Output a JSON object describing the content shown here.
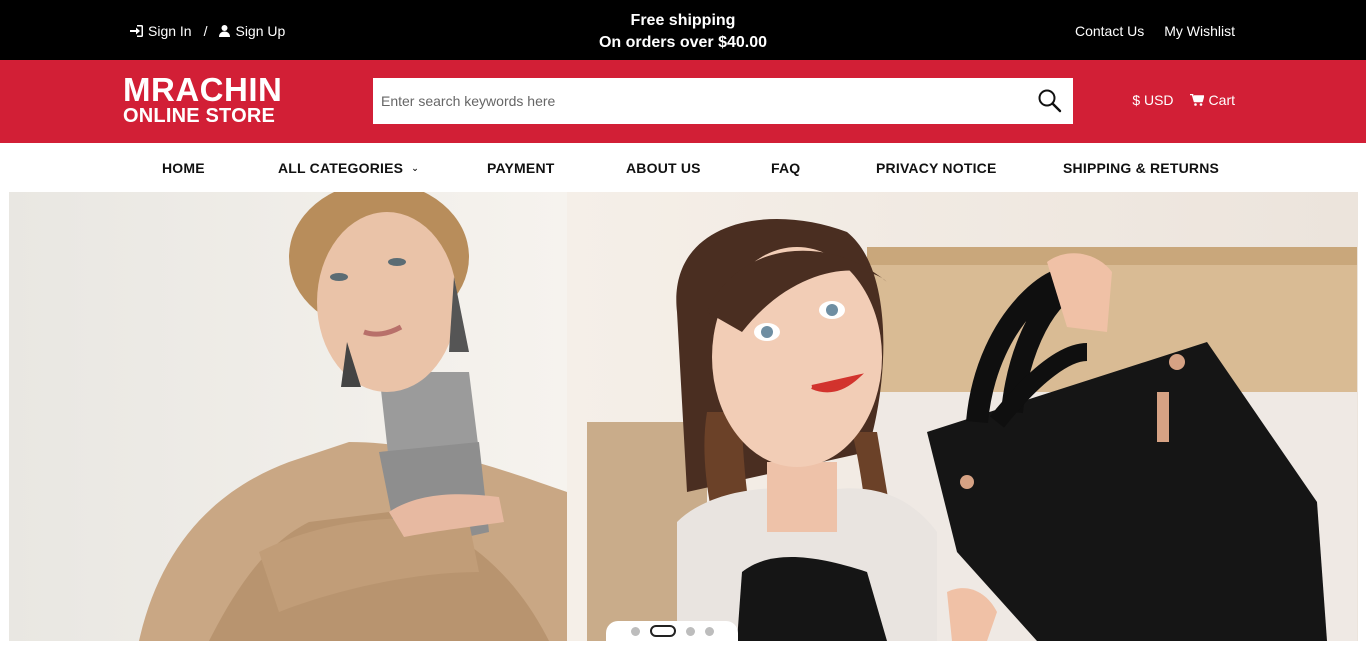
{
  "topbar": {
    "sign_in": "Sign In",
    "separator": "/",
    "sign_up": "Sign Up",
    "promo_line1": "Free shipping",
    "promo_line2": "On orders over $40.00",
    "contact_us": "Contact Us",
    "wishlist": "My Wishlist"
  },
  "header": {
    "logo_line1": "MRACHIN",
    "logo_line2": "ONLINE STORE",
    "search_placeholder": "Enter search keywords here",
    "currency": "$ USD",
    "cart": "Cart",
    "brand_color": "#d21f36"
  },
  "nav": {
    "items": [
      {
        "label": "HOME"
      },
      {
        "label": "ALL CATEGORIES"
      },
      {
        "label": "PAYMENT"
      },
      {
        "label": "ABOUT US"
      },
      {
        "label": "FAQ"
      },
      {
        "label": "PRIVACY NOTICE"
      },
      {
        "label": "SHIPPING & RETURNS"
      }
    ]
  },
  "hero": {
    "slide_count": 4,
    "active_slide": 2
  },
  "icons": {
    "sign_in": "sign-in-icon",
    "sign_up": "user-icon",
    "search": "search-icon",
    "cart": "cart-icon",
    "dropdown": "chevron-down-icon"
  }
}
